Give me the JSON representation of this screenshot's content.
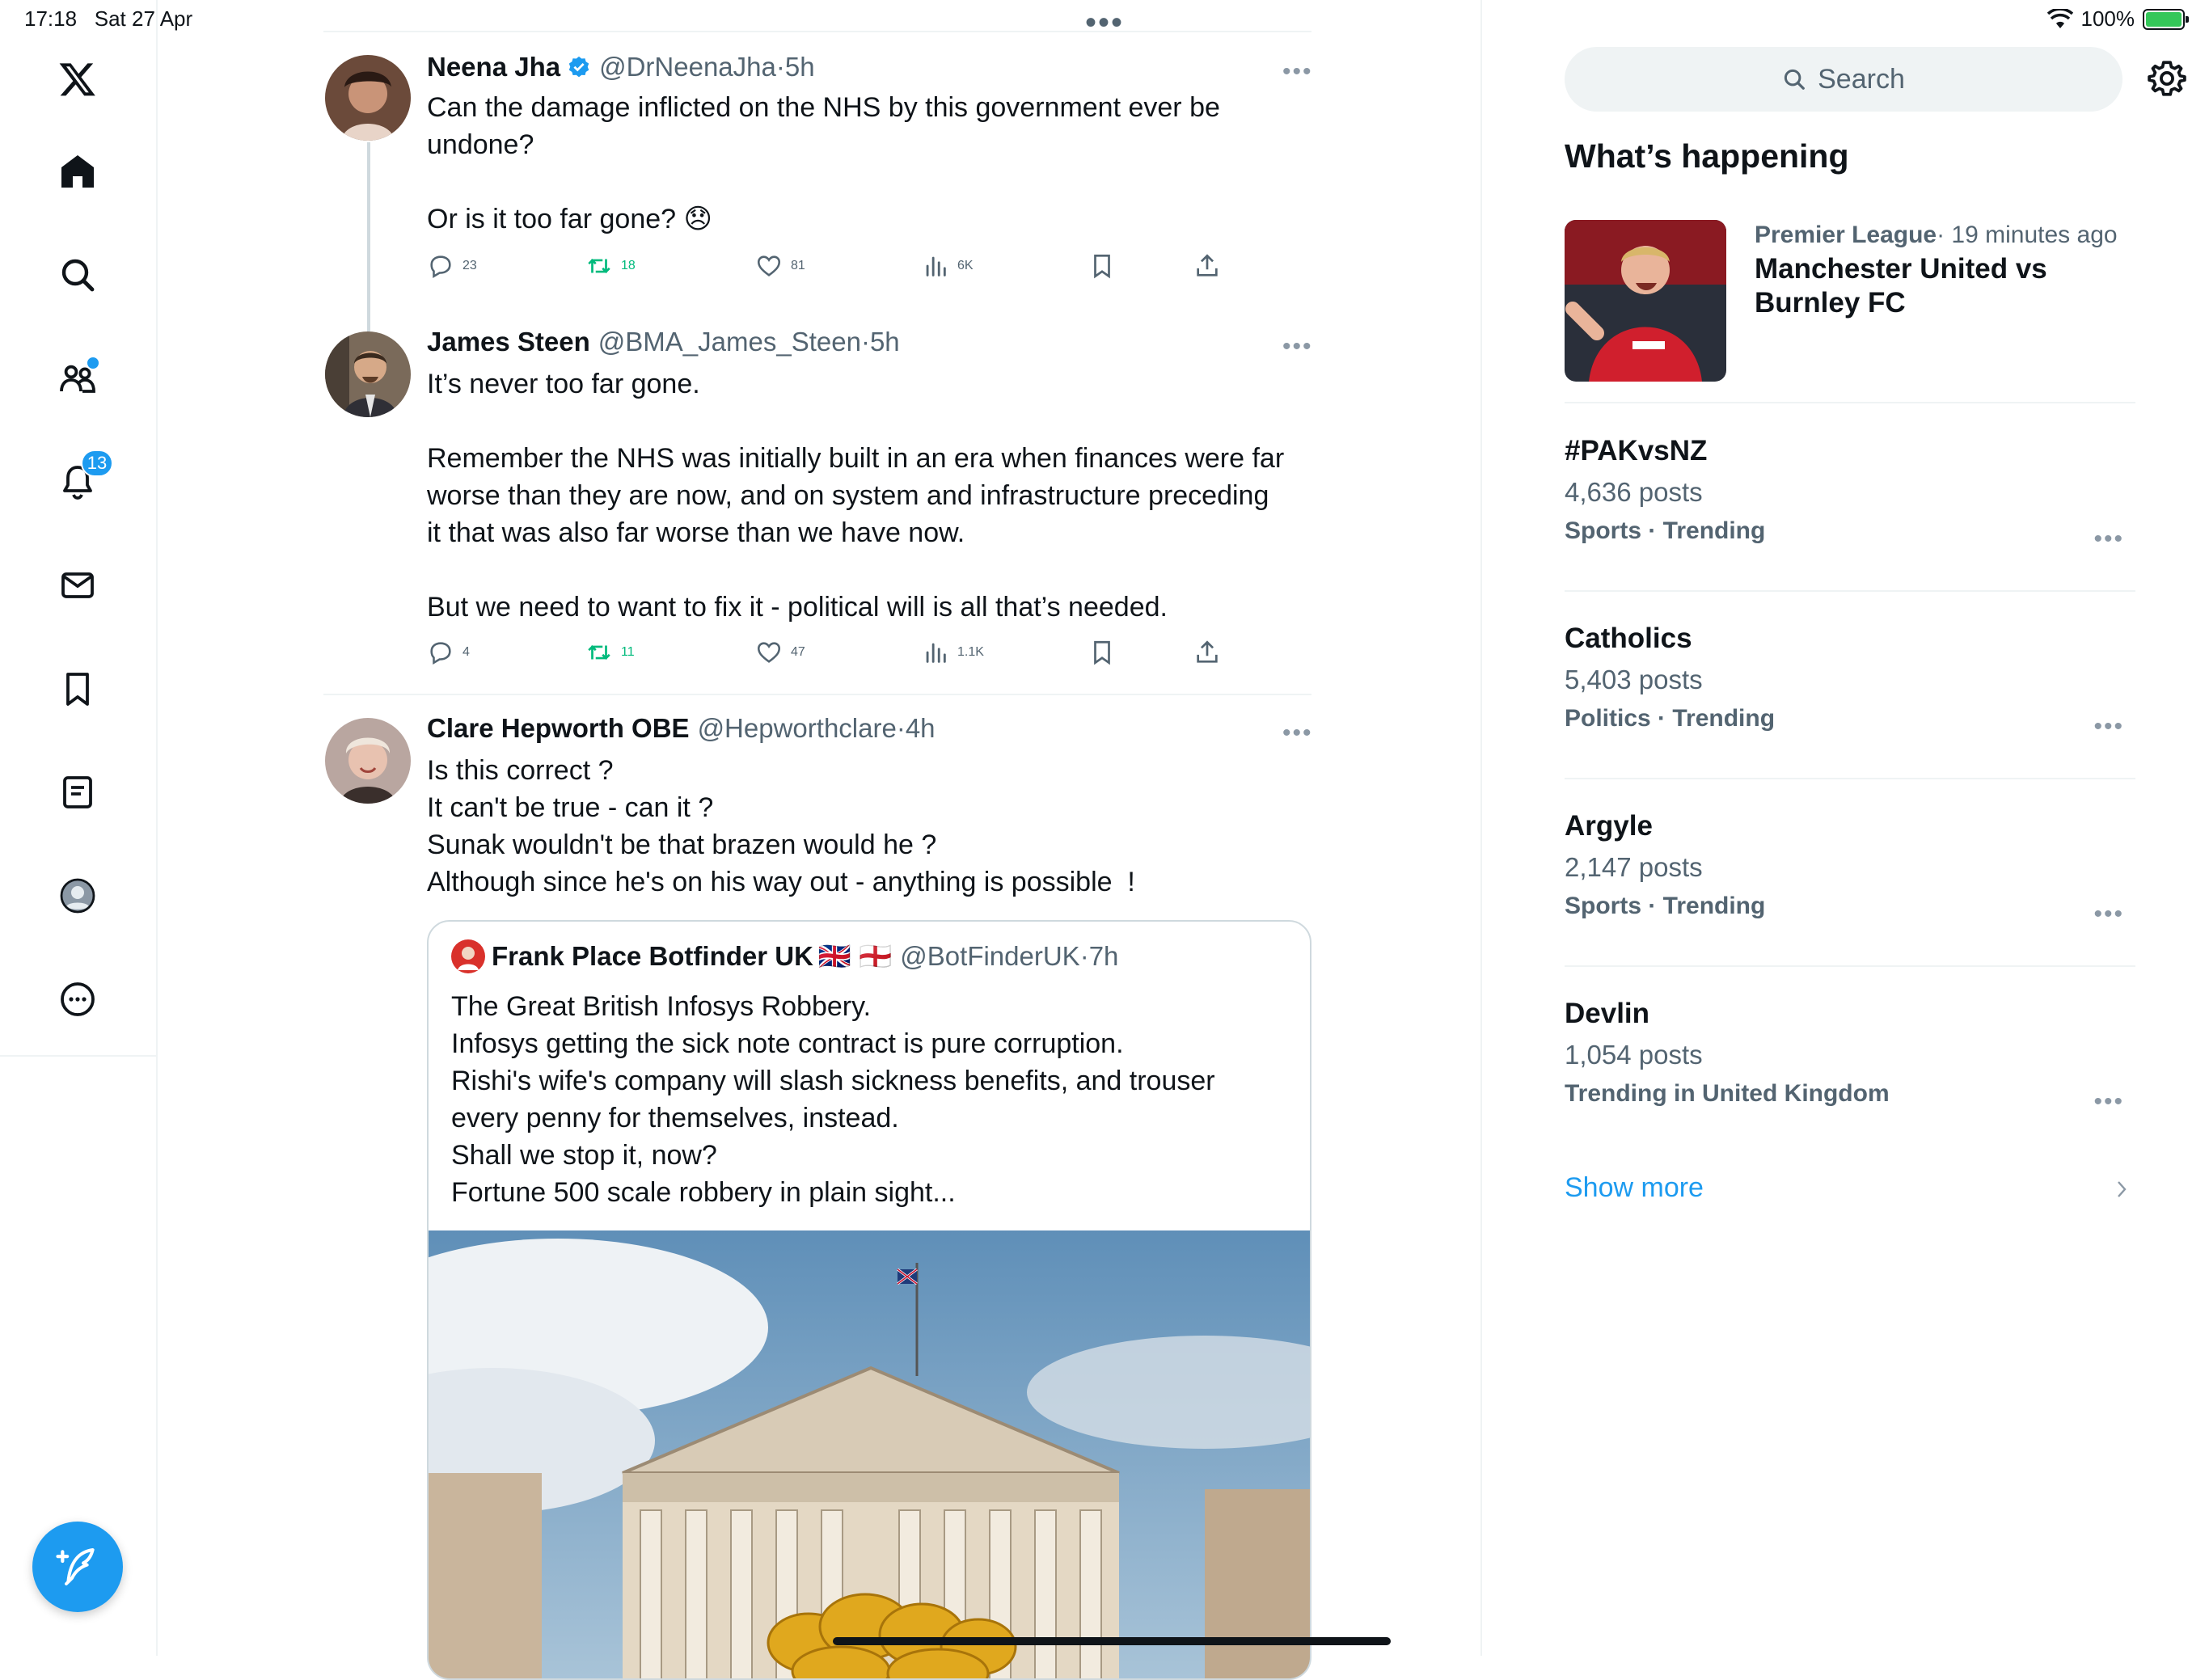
{
  "status": {
    "time": "17:18",
    "date": "Sat 27 Apr",
    "battery": "100%"
  },
  "nav": {
    "notifications_count": "13",
    "items": [
      "x-logo",
      "home",
      "explore",
      "communities",
      "notifications",
      "messages",
      "bookmarks",
      "lists",
      "profile",
      "more"
    ]
  },
  "tweets": [
    {
      "name": "Neena Jha",
      "handle": "@DrNeenaJha",
      "time": "·5h",
      "text": "Can the damage inflicted on the NHS by this government ever be\nundone?\n\nOr is it too far gone? 😞",
      "replies": "23",
      "retweets": "18",
      "likes": "81",
      "views": "6K"
    },
    {
      "name": "James Steen",
      "handle": "@BMA_James_Steen",
      "time": "·5h",
      "text": "It’s never too far gone.\n\nRemember the NHS was initially built in an era when finances were far\nworse than they are now, and on system and infrastructure preceding\nit that was also far worse than we have now.\n\nBut we need to want to fix it - political will is all that’s needed.",
      "replies": "4",
      "retweets": "11",
      "likes": "47",
      "views": "1.1K"
    },
    {
      "name": "Clare Hepworth OBE",
      "handle": "@Hepworthclare",
      "time": "·4h",
      "text": "Is this correct ?\nIt can't be true - can it ?\nSunak wouldn't be that brazen would he ?\nAlthough since he's on his way out - anything is possible  !"
    }
  ],
  "quote": {
    "name": "Frank Place Botfinder UK",
    "flags": "🇬🇧 🏴󠁧󠁢󠁥󠁮󠁧󠁿",
    "handle": "@BotFinderUK",
    "time": "·7h",
    "text": "The Great British Infosys Robbery.\nInfosys getting the sick note contract is pure corruption.\nRishi's wife's company will slash sickness benefits, and trouser\nevery penny for themselves, instead.\nShall we stop it, now?\nFortune 500 scale robbery in plain sight..."
  },
  "sidebar": {
    "search_placeholder": "Search",
    "whats_happening": "What’s happening",
    "featured": {
      "category": "Premier League",
      "time": "· 19 minutes ago",
      "title": "Manchester United vs\nBurnley FC"
    },
    "trends": [
      {
        "title": "#PAKvsNZ",
        "posts": "4,636 posts",
        "context": "Sports · Trending"
      },
      {
        "title": "Catholics",
        "posts": "5,403 posts",
        "context": "Politics · Trending"
      },
      {
        "title": "Argyle",
        "posts": "2,147 posts",
        "context": "Sports · Trending"
      },
      {
        "title": "Devlin",
        "posts": "1,054 posts",
        "context": "Trending in United Kingdom"
      }
    ],
    "show_more": "Show more"
  },
  "colors": {
    "accent": "#1d9bf0",
    "retweet": "#00ba7c",
    "muted": "#536471",
    "border": "#eff3f4"
  }
}
